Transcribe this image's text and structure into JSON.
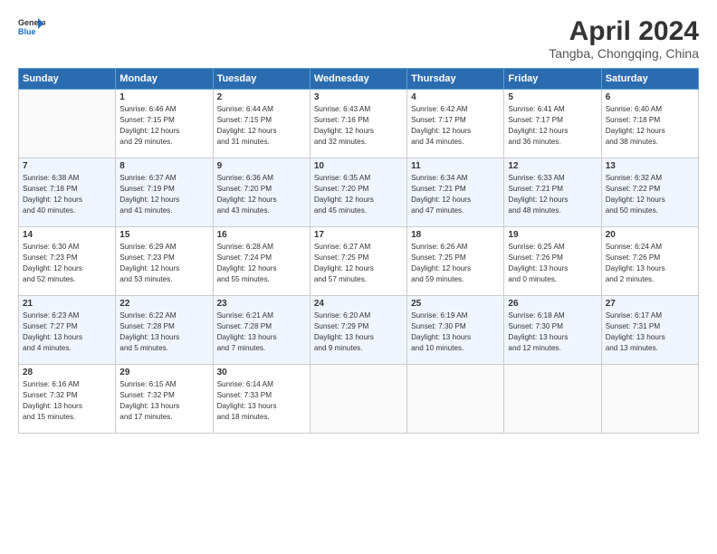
{
  "header": {
    "logo_general": "General",
    "logo_blue": "Blue",
    "title": "April 2024",
    "subtitle": "Tangba, Chongqing, China"
  },
  "days_of_week": [
    "Sunday",
    "Monday",
    "Tuesday",
    "Wednesday",
    "Thursday",
    "Friday",
    "Saturday"
  ],
  "weeks": [
    [
      {
        "day": "",
        "info": ""
      },
      {
        "day": "1",
        "info": "Sunrise: 6:46 AM\nSunset: 7:15 PM\nDaylight: 12 hours\nand 29 minutes."
      },
      {
        "day": "2",
        "info": "Sunrise: 6:44 AM\nSunset: 7:15 PM\nDaylight: 12 hours\nand 31 minutes."
      },
      {
        "day": "3",
        "info": "Sunrise: 6:43 AM\nSunset: 7:16 PM\nDaylight: 12 hours\nand 32 minutes."
      },
      {
        "day": "4",
        "info": "Sunrise: 6:42 AM\nSunset: 7:17 PM\nDaylight: 12 hours\nand 34 minutes."
      },
      {
        "day": "5",
        "info": "Sunrise: 6:41 AM\nSunset: 7:17 PM\nDaylight: 12 hours\nand 36 minutes."
      },
      {
        "day": "6",
        "info": "Sunrise: 6:40 AM\nSunset: 7:18 PM\nDaylight: 12 hours\nand 38 minutes."
      }
    ],
    [
      {
        "day": "7",
        "info": "Sunrise: 6:38 AM\nSunset: 7:18 PM\nDaylight: 12 hours\nand 40 minutes."
      },
      {
        "day": "8",
        "info": "Sunrise: 6:37 AM\nSunset: 7:19 PM\nDaylight: 12 hours\nand 41 minutes."
      },
      {
        "day": "9",
        "info": "Sunrise: 6:36 AM\nSunset: 7:20 PM\nDaylight: 12 hours\nand 43 minutes."
      },
      {
        "day": "10",
        "info": "Sunrise: 6:35 AM\nSunset: 7:20 PM\nDaylight: 12 hours\nand 45 minutes."
      },
      {
        "day": "11",
        "info": "Sunrise: 6:34 AM\nSunset: 7:21 PM\nDaylight: 12 hours\nand 47 minutes."
      },
      {
        "day": "12",
        "info": "Sunrise: 6:33 AM\nSunset: 7:21 PM\nDaylight: 12 hours\nand 48 minutes."
      },
      {
        "day": "13",
        "info": "Sunrise: 6:32 AM\nSunset: 7:22 PM\nDaylight: 12 hours\nand 50 minutes."
      }
    ],
    [
      {
        "day": "14",
        "info": "Sunrise: 6:30 AM\nSunset: 7:23 PM\nDaylight: 12 hours\nand 52 minutes."
      },
      {
        "day": "15",
        "info": "Sunrise: 6:29 AM\nSunset: 7:23 PM\nDaylight: 12 hours\nand 53 minutes."
      },
      {
        "day": "16",
        "info": "Sunrise: 6:28 AM\nSunset: 7:24 PM\nDaylight: 12 hours\nand 55 minutes."
      },
      {
        "day": "17",
        "info": "Sunrise: 6:27 AM\nSunset: 7:25 PM\nDaylight: 12 hours\nand 57 minutes."
      },
      {
        "day": "18",
        "info": "Sunrise: 6:26 AM\nSunset: 7:25 PM\nDaylight: 12 hours\nand 59 minutes."
      },
      {
        "day": "19",
        "info": "Sunrise: 6:25 AM\nSunset: 7:26 PM\nDaylight: 13 hours\nand 0 minutes."
      },
      {
        "day": "20",
        "info": "Sunrise: 6:24 AM\nSunset: 7:26 PM\nDaylight: 13 hours\nand 2 minutes."
      }
    ],
    [
      {
        "day": "21",
        "info": "Sunrise: 6:23 AM\nSunset: 7:27 PM\nDaylight: 13 hours\nand 4 minutes."
      },
      {
        "day": "22",
        "info": "Sunrise: 6:22 AM\nSunset: 7:28 PM\nDaylight: 13 hours\nand 5 minutes."
      },
      {
        "day": "23",
        "info": "Sunrise: 6:21 AM\nSunset: 7:28 PM\nDaylight: 13 hours\nand 7 minutes."
      },
      {
        "day": "24",
        "info": "Sunrise: 6:20 AM\nSunset: 7:29 PM\nDaylight: 13 hours\nand 9 minutes."
      },
      {
        "day": "25",
        "info": "Sunrise: 6:19 AM\nSunset: 7:30 PM\nDaylight: 13 hours\nand 10 minutes."
      },
      {
        "day": "26",
        "info": "Sunrise: 6:18 AM\nSunset: 7:30 PM\nDaylight: 13 hours\nand 12 minutes."
      },
      {
        "day": "27",
        "info": "Sunrise: 6:17 AM\nSunset: 7:31 PM\nDaylight: 13 hours\nand 13 minutes."
      }
    ],
    [
      {
        "day": "28",
        "info": "Sunrise: 6:16 AM\nSunset: 7:32 PM\nDaylight: 13 hours\nand 15 minutes."
      },
      {
        "day": "29",
        "info": "Sunrise: 6:15 AM\nSunset: 7:32 PM\nDaylight: 13 hours\nand 17 minutes."
      },
      {
        "day": "30",
        "info": "Sunrise: 6:14 AM\nSunset: 7:33 PM\nDaylight: 13 hours\nand 18 minutes."
      },
      {
        "day": "",
        "info": ""
      },
      {
        "day": "",
        "info": ""
      },
      {
        "day": "",
        "info": ""
      },
      {
        "day": "",
        "info": ""
      }
    ]
  ]
}
